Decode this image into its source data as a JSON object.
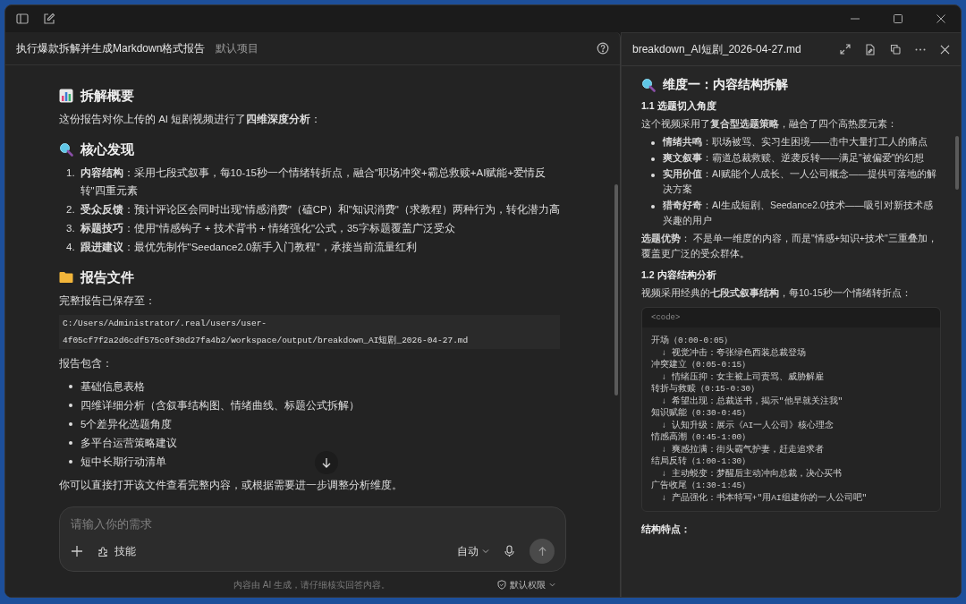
{
  "chat": {
    "title": "执行爆款拆解并生成Markdown格式报告",
    "project": "默认项目",
    "blocks": [
      {
        "kind": "heading",
        "text": "拆解概要"
      },
      {
        "kind": "paragraph",
        "text": "这份报告对你上传的 AI 短剧视频进行了**四维深度分析**："
      },
      {
        "kind": "heading",
        "text": "核心发现"
      },
      {
        "kind": "ordered",
        "items": [
          {
            "number": "1.",
            "text": "**内容结构**：采用七段式叙事，每10-15秒一个情绪转折点，融合\"职场冲突+霸总救赎+AI赋能+爱情反转\"四重元素"
          },
          {
            "number": "2.",
            "text": "**受众反馈**：预计评论区会同时出现\"情感消费\"（磕CP）和\"知识消费\"（求教程）两种行为，转化潜力高"
          },
          {
            "number": "3.",
            "text": "**标题技巧**：使用\"情感钩子 + 技术背书 + 情绪强化\"公式，35字标题覆盖广泛受众"
          },
          {
            "number": "4.",
            "text": "**跟进建议**：最优先制作\"Seedance2.0新手入门教程\"，承接当前流量红利"
          }
        ]
      },
      {
        "kind": "heading",
        "text": "报告文件"
      },
      {
        "kind": "paragraph",
        "text": "完整报告已保存至："
      },
      {
        "kind": "path",
        "text": "C:/Users/Administrator/.real/users/user-4f05cf7f2a2d6cdf575c0f30d27fa4b2/workspace/output/breakdown_AI短剧_2026-04-27.md"
      },
      {
        "kind": "paragraph",
        "text": "报告包含："
      },
      {
        "kind": "bullets",
        "items": [
          "基础信息表格",
          "四维详细分析（含叙事结构图、情绪曲线、标题公式拆解）",
          "5个差异化选题角度",
          "多平台运营策略建议",
          "短中长期行动清单"
        ]
      },
      {
        "kind": "paragraph",
        "text": "你可以直接打开该文件查看完整内容，或根据需要进一步调整分析维度。"
      }
    ],
    "input": {
      "placeholder": "请输入你的需求",
      "skills": "技能",
      "mode": "自动",
      "send_disabled": true
    },
    "disclaimer": "内容由 AI 生成，请仔细核实回答内容。",
    "permission": "默认权限"
  },
  "preview": {
    "filename": "breakdown_AI短剧_2026-04-27.md",
    "blocks": [
      {
        "kind": "heading",
        "text": "维度一：内容结构拆解"
      },
      {
        "kind": "subheading",
        "text": "1.1 选题切入角度"
      },
      {
        "kind": "paragraph",
        "text": "这个视频采用了**复合型选题策略**，融合了四个高热度元素："
      },
      {
        "kind": "bullets",
        "items": [
          "**情绪共鸣**：职场被骂、实习生困境——击中大量打工人的痛点",
          "**爽文叙事**：霸道总裁救赎、逆袭反转——满足\"被偏爱\"的幻想",
          "**实用价值**：AI赋能个人成长、一人公司概念——提供可落地的解决方案",
          "**猎奇好奇**：AI生成短剧、Seedance2.0技术——吸引对新技术感兴趣的用户"
        ]
      },
      {
        "kind": "paragraph",
        "text": "**选题优势**： 不是单一维度的内容，而是\"情感+知识+技术\"三重叠加，覆盖更广泛的受众群体。"
      },
      {
        "kind": "subheading",
        "text": "1.2 内容结构分析"
      },
      {
        "kind": "paragraph",
        "text": "视频采用经典的**七段式叙事结构**，每10-15秒一个情绪转折点："
      },
      {
        "kind": "code",
        "label": "<code>",
        "lines": [
          "开场（0:00-0:05）",
          "  ↓ 视觉冲击：夸张绿色西装总裁登场",
          "冲突建立（0:05-0:15）",
          "  ↓ 情绪压抑：女主被上司责骂、威胁解雇",
          "转折与救赎（0:15-0:30）",
          "  ↓ 希望出现：总裁送书，揭示\"他早就关注我\"",
          "知识赋能（0:30-0:45）",
          "  ↓ 认知升级：展示《AI一人公司》核心理念",
          "情感高潮（0:45-1:00）",
          "  ↓ 爽感拉满：街头霸气护妻，赶走追求者",
          "结局反转（1:00-1:30）",
          "  ↓ 主动蜕变：梦醒后主动冲向总裁，决心买书",
          "广告收尾（1:30-1:45）",
          "  ↓ 产品强化：书本特写+\"用AI组建你的一人公司吧\""
        ]
      },
      {
        "kind": "subheading",
        "text": "结构特点："
      }
    ]
  }
}
